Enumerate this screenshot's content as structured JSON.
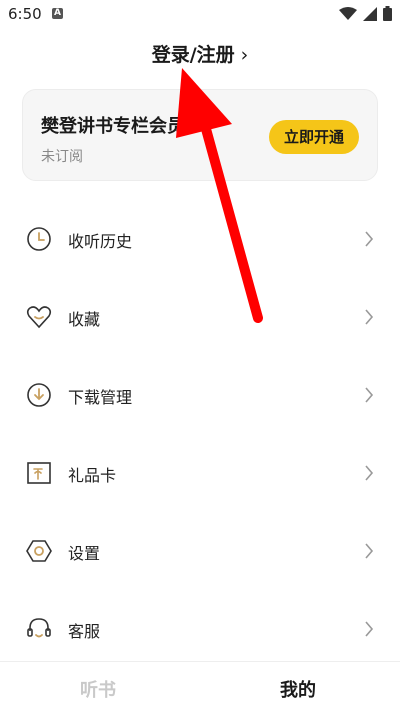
{
  "status_bar": {
    "time": "6:50",
    "notification_badge": "A",
    "icons": [
      "wifi-icon",
      "signal-icon",
      "battery-icon"
    ]
  },
  "header": {
    "login_label": "登录/注册",
    "chevron": "›"
  },
  "vip_card": {
    "title": "樊登讲书专栏会员",
    "subtitle": "未订阅",
    "button_label": "立即开通",
    "button_color": "#f5c518"
  },
  "menu": {
    "items": [
      {
        "label": "收听历史",
        "icon": "clock-icon"
      },
      {
        "label": "收藏",
        "icon": "heart-icon"
      },
      {
        "label": "下载管理",
        "icon": "download-icon"
      },
      {
        "label": "礼品卡",
        "icon": "gift-card-icon"
      },
      {
        "label": "设置",
        "icon": "settings-icon"
      },
      {
        "label": "客服",
        "icon": "headset-icon"
      }
    ]
  },
  "bottom_nav": {
    "tabs": [
      {
        "label": "听书",
        "active": false
      },
      {
        "label": "我的",
        "active": true
      }
    ]
  },
  "colors": {
    "accent": "#f5c518",
    "icon_stroke": "#333333",
    "icon_accent": "#c8a060",
    "annotation_arrow": "#ff0000"
  }
}
